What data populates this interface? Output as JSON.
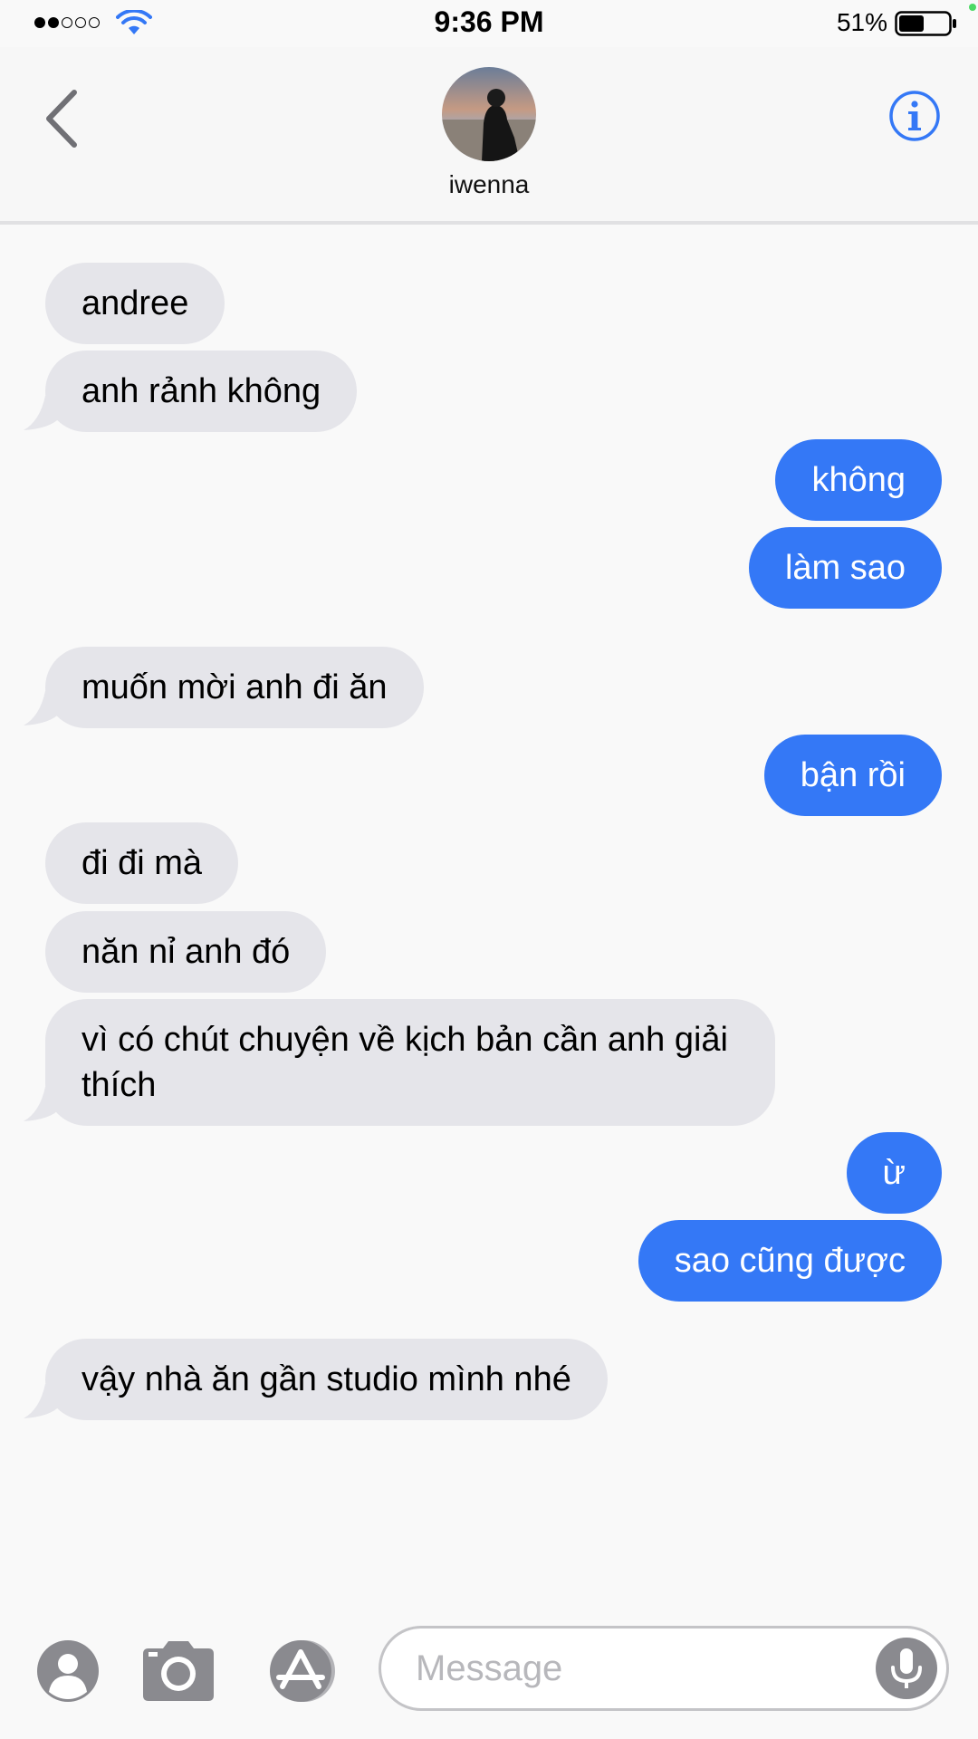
{
  "status_bar": {
    "time": "9:36 PM",
    "battery_percent": "51%",
    "battery_level": 0.51,
    "signal_bars_filled": 2,
    "signal_bars_total": 5
  },
  "header": {
    "contact_name": "iwenna",
    "back_icon": "chevron-left-icon",
    "info_icon": "info-icon"
  },
  "messages": [
    {
      "side": "in",
      "text": "andree"
    },
    {
      "side": "in",
      "text": "anh rảnh không"
    },
    {
      "side": "out",
      "text": "không"
    },
    {
      "side": "out",
      "text": "làm sao"
    },
    {
      "side": "in",
      "text": "muốn mời anh đi ăn"
    },
    {
      "side": "out",
      "text": "bận rồi"
    },
    {
      "side": "in",
      "text": "đi đi mà"
    },
    {
      "side": "in",
      "text": "năn nỉ anh đó"
    },
    {
      "side": "in",
      "text": "vì có chút chuyện về kịch bản cần anh giải thích"
    },
    {
      "side": "out",
      "text": "ừ"
    },
    {
      "side": "out",
      "text": "sao cũng được"
    },
    {
      "side": "in",
      "text": "vậy nhà ăn gần studio mình nhé"
    }
  ],
  "input_bar": {
    "placeholder": "Message",
    "icons": [
      "contact-icon",
      "camera-icon",
      "app-store-icon",
      "microphone-icon"
    ]
  },
  "colors": {
    "outgoing_bubble": "#3478f6",
    "incoming_bubble": "#e5e5ea",
    "accent": "#3478f6",
    "charging": "#4cd964"
  }
}
